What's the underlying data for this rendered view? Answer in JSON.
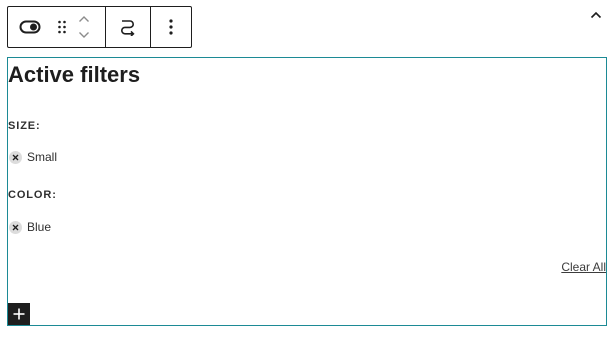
{
  "toolbar": {
    "block_icon": "toggle-icon",
    "drag_icon": "drag-handle-icon",
    "move_up_icon": "chevron-up-icon",
    "move_down_icon": "chevron-down-icon",
    "transform_icon": "transform-icon",
    "options_icon": "more-vertical-icon",
    "collapse_icon": "chevron-up-icon"
  },
  "block": {
    "title": "Active filters",
    "filters": [
      {
        "heading": "SIZE:",
        "value": "Small",
        "remove_icon": "close-icon"
      },
      {
        "heading": "COLOR:",
        "value": "Blue",
        "remove_icon": "close-icon"
      }
    ],
    "clear_all": "Clear All",
    "inserter_icon": "plus-icon",
    "border_color": "#1c8a95"
  }
}
